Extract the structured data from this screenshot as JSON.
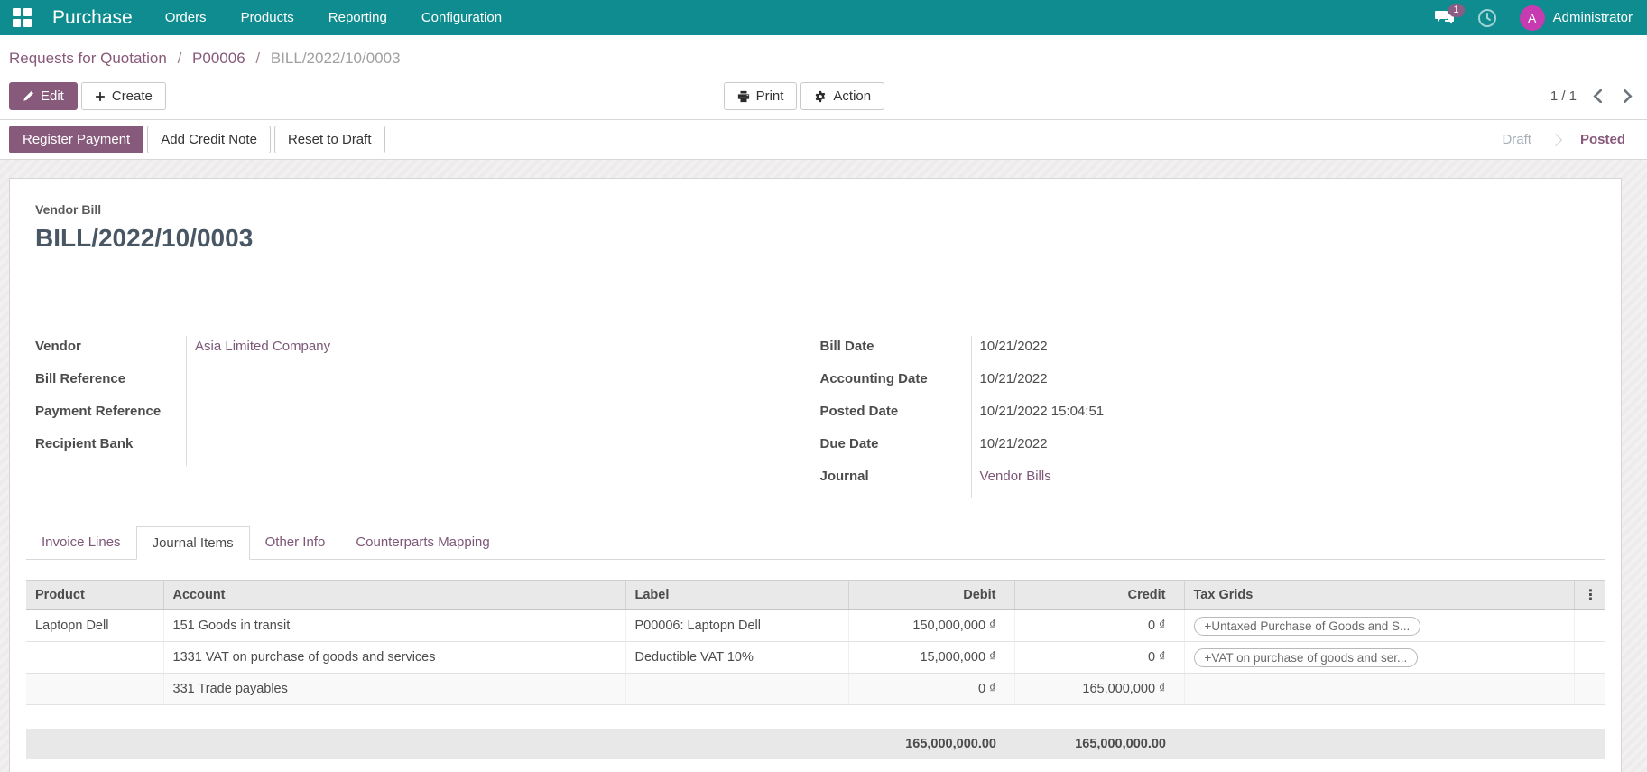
{
  "navbar": {
    "app_name": "Purchase",
    "menus": [
      "Orders",
      "Products",
      "Reporting",
      "Configuration"
    ],
    "messages_badge": "1",
    "user_name": "Administrator",
    "avatar_initial": "A"
  },
  "breadcrumb": {
    "links": [
      "Requests for Quotation",
      "P00006"
    ],
    "separator": "/",
    "current": "BILL/2022/10/0003"
  },
  "control_panel": {
    "edit_label": "Edit",
    "create_label": "Create",
    "print_label": "Print",
    "action_label": "Action",
    "pager": "1 / 1"
  },
  "statusbar": {
    "buttons": [
      "Register Payment",
      "Add Credit Note",
      "Reset to Draft"
    ],
    "states": [
      "Draft",
      "Posted"
    ],
    "active_state": "Posted"
  },
  "sheet": {
    "doc_type_label": "Vendor Bill",
    "doc_name": "BILL/2022/10/0003"
  },
  "fields": {
    "left": [
      {
        "label": "Vendor",
        "value": "Asia Limited Company"
      },
      {
        "label": "Bill Reference",
        "value": ""
      },
      {
        "label": "Payment Reference",
        "value": ""
      },
      {
        "label": "Recipient Bank",
        "value": ""
      }
    ],
    "right": [
      {
        "label": "Bill Date",
        "value": "10/21/2022"
      },
      {
        "label": "Accounting Date",
        "value": "10/21/2022"
      },
      {
        "label": "Posted Date",
        "value": "10/21/2022 15:04:51"
      },
      {
        "label": "Due Date",
        "value": "10/21/2022"
      },
      {
        "label": "Journal",
        "value": "Vendor Bills"
      }
    ]
  },
  "tabs": {
    "items": [
      "Invoice Lines",
      "Journal Items",
      "Other Info",
      "Counterparts Mapping"
    ],
    "active": "Journal Items"
  },
  "journal_table": {
    "columns": [
      "Product",
      "Account",
      "Label",
      "Debit",
      "Credit",
      "Tax Grids"
    ],
    "rows": [
      {
        "product": "Laptopn Dell",
        "account": "151 Goods in transit",
        "label": "P00006: Laptopn Dell",
        "debit": "150,000,000 ₫",
        "credit": "0 ₫",
        "tax_grid": "+Untaxed Purchase of Goods and S..."
      },
      {
        "product": "",
        "account": "1331 VAT on purchase of goods and services",
        "label": "Deductible VAT 10%",
        "debit": "15,000,000 ₫",
        "credit": "0 ₫",
        "tax_grid": "+VAT on purchase of goods and ser..."
      },
      {
        "product": "",
        "account": "331 Trade payables",
        "label": "",
        "debit": "0 ₫",
        "credit": "165,000,000 ₫",
        "tax_grid": ""
      }
    ],
    "totals": {
      "debit": "165,000,000.00",
      "credit": "165,000,000.00"
    }
  },
  "colors": {
    "navbar_teal": "#0e8c8f",
    "brand_purple": "#875A7B",
    "link_purple": "#7c5777",
    "avatar_magenta": "#c63bb0"
  }
}
